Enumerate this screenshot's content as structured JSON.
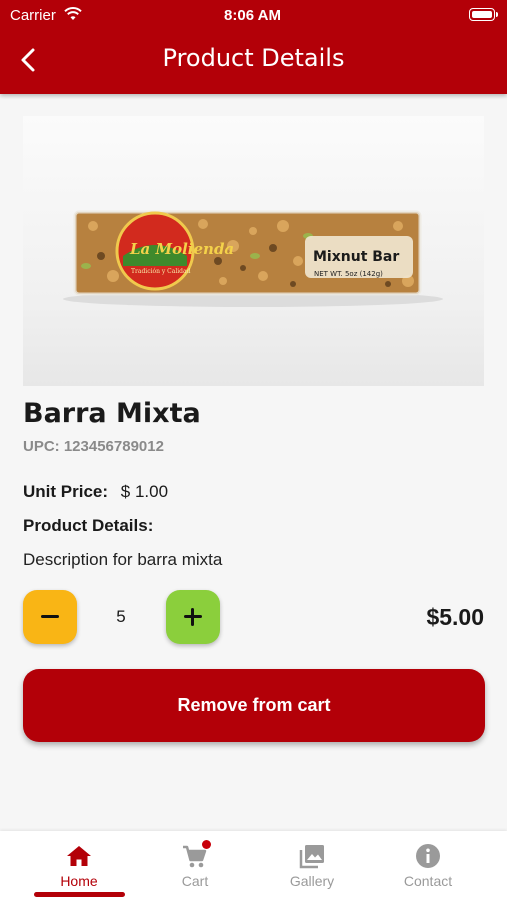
{
  "status_bar": {
    "carrier": "Carrier",
    "time": "8:06 AM"
  },
  "header": {
    "title": "Product Details"
  },
  "product": {
    "name": "Barra Mixta",
    "upc_label": "UPC:",
    "upc": "123456789012",
    "unit_price_label": "Unit Price:",
    "unit_price": "$ 1.00",
    "details_label": "Product Details:",
    "description": "Description for barra mixta",
    "image_text": {
      "brand": "La Molienda",
      "tagline": "Tradición y Calidad",
      "name": "Mixnut Bar",
      "weight": "NET WT. 5oz (142g)"
    }
  },
  "cart": {
    "quantity": "5",
    "total": "$5.00",
    "remove_label": "Remove from cart"
  },
  "tabs": [
    {
      "label": "Home",
      "icon": "home-icon",
      "active": true
    },
    {
      "label": "Cart",
      "icon": "cart-icon",
      "active": false
    },
    {
      "label": "Gallery",
      "icon": "gallery-icon",
      "active": false
    },
    {
      "label": "Contact",
      "icon": "info-icon",
      "active": false
    }
  ],
  "colors": {
    "primary": "#b30008",
    "minus": "#f9b515",
    "plus": "#8bcf3c",
    "inactive": "#9a9a9a"
  }
}
